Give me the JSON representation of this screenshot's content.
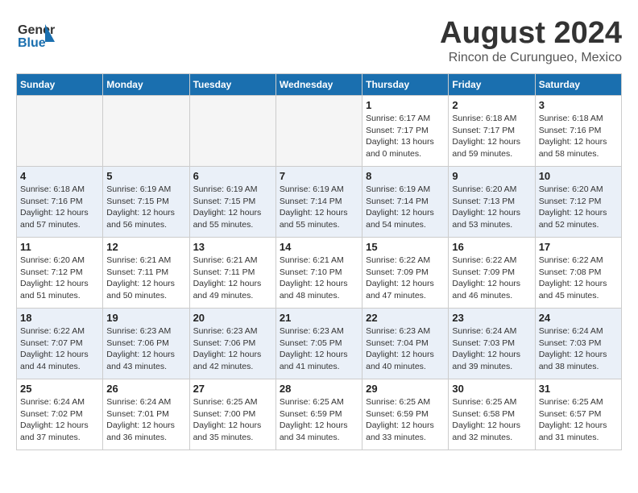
{
  "header": {
    "logo_line1": "General",
    "logo_line2": "Blue",
    "main_title": "August 2024",
    "subtitle": "Rincon de Curungueo, Mexico"
  },
  "calendar": {
    "days_of_week": [
      "Sunday",
      "Monday",
      "Tuesday",
      "Wednesday",
      "Thursday",
      "Friday",
      "Saturday"
    ],
    "weeks": [
      [
        {
          "day": "",
          "info": ""
        },
        {
          "day": "",
          "info": ""
        },
        {
          "day": "",
          "info": ""
        },
        {
          "day": "",
          "info": ""
        },
        {
          "day": "1",
          "info": "Sunrise: 6:17 AM\nSunset: 7:17 PM\nDaylight: 13 hours\nand 0 minutes."
        },
        {
          "day": "2",
          "info": "Sunrise: 6:18 AM\nSunset: 7:17 PM\nDaylight: 12 hours\nand 59 minutes."
        },
        {
          "day": "3",
          "info": "Sunrise: 6:18 AM\nSunset: 7:16 PM\nDaylight: 12 hours\nand 58 minutes."
        }
      ],
      [
        {
          "day": "4",
          "info": "Sunrise: 6:18 AM\nSunset: 7:16 PM\nDaylight: 12 hours\nand 57 minutes."
        },
        {
          "day": "5",
          "info": "Sunrise: 6:19 AM\nSunset: 7:15 PM\nDaylight: 12 hours\nand 56 minutes."
        },
        {
          "day": "6",
          "info": "Sunrise: 6:19 AM\nSunset: 7:15 PM\nDaylight: 12 hours\nand 55 minutes."
        },
        {
          "day": "7",
          "info": "Sunrise: 6:19 AM\nSunset: 7:14 PM\nDaylight: 12 hours\nand 55 minutes."
        },
        {
          "day": "8",
          "info": "Sunrise: 6:19 AM\nSunset: 7:14 PM\nDaylight: 12 hours\nand 54 minutes."
        },
        {
          "day": "9",
          "info": "Sunrise: 6:20 AM\nSunset: 7:13 PM\nDaylight: 12 hours\nand 53 minutes."
        },
        {
          "day": "10",
          "info": "Sunrise: 6:20 AM\nSunset: 7:12 PM\nDaylight: 12 hours\nand 52 minutes."
        }
      ],
      [
        {
          "day": "11",
          "info": "Sunrise: 6:20 AM\nSunset: 7:12 PM\nDaylight: 12 hours\nand 51 minutes."
        },
        {
          "day": "12",
          "info": "Sunrise: 6:21 AM\nSunset: 7:11 PM\nDaylight: 12 hours\nand 50 minutes."
        },
        {
          "day": "13",
          "info": "Sunrise: 6:21 AM\nSunset: 7:11 PM\nDaylight: 12 hours\nand 49 minutes."
        },
        {
          "day": "14",
          "info": "Sunrise: 6:21 AM\nSunset: 7:10 PM\nDaylight: 12 hours\nand 48 minutes."
        },
        {
          "day": "15",
          "info": "Sunrise: 6:22 AM\nSunset: 7:09 PM\nDaylight: 12 hours\nand 47 minutes."
        },
        {
          "day": "16",
          "info": "Sunrise: 6:22 AM\nSunset: 7:09 PM\nDaylight: 12 hours\nand 46 minutes."
        },
        {
          "day": "17",
          "info": "Sunrise: 6:22 AM\nSunset: 7:08 PM\nDaylight: 12 hours\nand 45 minutes."
        }
      ],
      [
        {
          "day": "18",
          "info": "Sunrise: 6:22 AM\nSunset: 7:07 PM\nDaylight: 12 hours\nand 44 minutes."
        },
        {
          "day": "19",
          "info": "Sunrise: 6:23 AM\nSunset: 7:06 PM\nDaylight: 12 hours\nand 43 minutes."
        },
        {
          "day": "20",
          "info": "Sunrise: 6:23 AM\nSunset: 7:06 PM\nDaylight: 12 hours\nand 42 minutes."
        },
        {
          "day": "21",
          "info": "Sunrise: 6:23 AM\nSunset: 7:05 PM\nDaylight: 12 hours\nand 41 minutes."
        },
        {
          "day": "22",
          "info": "Sunrise: 6:23 AM\nSunset: 7:04 PM\nDaylight: 12 hours\nand 40 minutes."
        },
        {
          "day": "23",
          "info": "Sunrise: 6:24 AM\nSunset: 7:03 PM\nDaylight: 12 hours\nand 39 minutes."
        },
        {
          "day": "24",
          "info": "Sunrise: 6:24 AM\nSunset: 7:03 PM\nDaylight: 12 hours\nand 38 minutes."
        }
      ],
      [
        {
          "day": "25",
          "info": "Sunrise: 6:24 AM\nSunset: 7:02 PM\nDaylight: 12 hours\nand 37 minutes."
        },
        {
          "day": "26",
          "info": "Sunrise: 6:24 AM\nSunset: 7:01 PM\nDaylight: 12 hours\nand 36 minutes."
        },
        {
          "day": "27",
          "info": "Sunrise: 6:25 AM\nSunset: 7:00 PM\nDaylight: 12 hours\nand 35 minutes."
        },
        {
          "day": "28",
          "info": "Sunrise: 6:25 AM\nSunset: 6:59 PM\nDaylight: 12 hours\nand 34 minutes."
        },
        {
          "day": "29",
          "info": "Sunrise: 6:25 AM\nSunset: 6:59 PM\nDaylight: 12 hours\nand 33 minutes."
        },
        {
          "day": "30",
          "info": "Sunrise: 6:25 AM\nSunset: 6:58 PM\nDaylight: 12 hours\nand 32 minutes."
        },
        {
          "day": "31",
          "info": "Sunrise: 6:25 AM\nSunset: 6:57 PM\nDaylight: 12 hours\nand 31 minutes."
        }
      ]
    ]
  }
}
